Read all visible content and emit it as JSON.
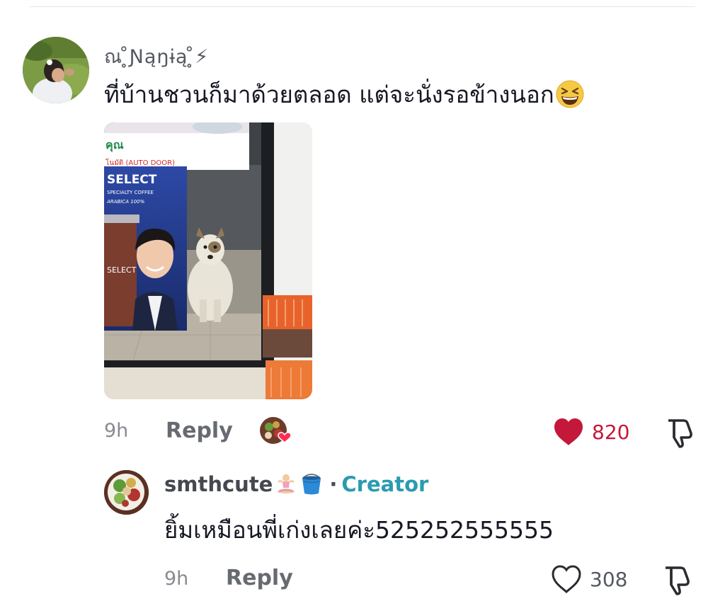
{
  "comment": {
    "username": "ณ ̥̊Ɲąŋɨą ̥̊⚡",
    "text": "ที่บ้านชวนก็มาด้วยตลอด แต่จะนั่งรอข้างนอก",
    "emoji": "grinning-squinting-face",
    "photo": {
      "sign_thai": "คุณ",
      "sign_auto": "โนมัติ (AUTO DOOR)",
      "poster_brand": "SELECT",
      "poster_sub": "SPECIALTY COFFEE",
      "poster_arabica": "ARABICA 100%",
      "cup_brand": "SELECT"
    },
    "time": "9h",
    "reply_label": "Reply",
    "like_count": "820",
    "liked": true,
    "like_color": "#c3183a",
    "liked_by_creator_badge_color": "#fe2c55"
  },
  "reply": {
    "username": "smthcute",
    "username_emojis": [
      "person-in-lotus-position",
      "bucket"
    ],
    "separator": "·",
    "badge": "Creator",
    "badge_color": "#2a9bb0",
    "text": "ยิ้มเหมือนพี่เก่งเลยค่ะ525252555555",
    "time": "9h",
    "reply_label": "Reply",
    "like_count": "308",
    "liked": false
  }
}
